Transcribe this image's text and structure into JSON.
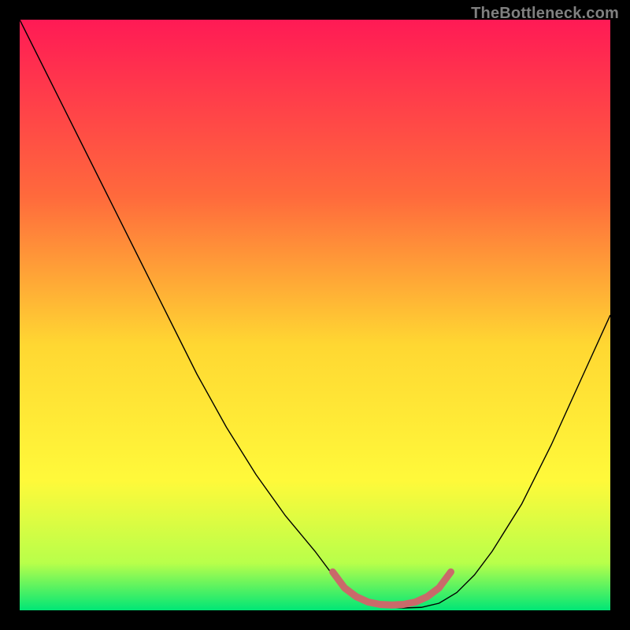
{
  "watermark": "TheBottleneck.com",
  "chart_data": {
    "type": "line",
    "title": "",
    "xlabel": "",
    "ylabel": "",
    "xlim": [
      0,
      100
    ],
    "ylim": [
      0,
      100
    ],
    "background_gradient": {
      "stops": [
        {
          "offset": 0.0,
          "color": "#ff1a55"
        },
        {
          "offset": 0.3,
          "color": "#ff6a3c"
        },
        {
          "offset": 0.55,
          "color": "#ffd732"
        },
        {
          "offset": 0.78,
          "color": "#fff93a"
        },
        {
          "offset": 0.92,
          "color": "#b8ff4a"
        },
        {
          "offset": 1.0,
          "color": "#00e676"
        }
      ]
    },
    "series": [
      {
        "name": "bottleneck-curve",
        "x": [
          0,
          5,
          10,
          15,
          20,
          25,
          30,
          35,
          40,
          45,
          50,
          53,
          56,
          59,
          62,
          65,
          68,
          71,
          74,
          77,
          80,
          85,
          90,
          95,
          100
        ],
        "y": [
          100,
          90,
          80,
          70,
          60,
          50,
          40,
          31,
          23,
          16,
          10,
          6,
          3,
          1.2,
          0.5,
          0.4,
          0.5,
          1.2,
          3,
          6,
          10,
          18,
          28,
          39,
          50
        ],
        "stroke": "#000000",
        "stroke_width": 1.4
      },
      {
        "name": "optimum-band",
        "x": [
          53,
          55,
          57,
          59,
          61,
          63,
          65,
          67,
          69,
          71,
          73
        ],
        "y": [
          6.5,
          3.8,
          2.3,
          1.4,
          1.0,
          0.9,
          1.0,
          1.4,
          2.3,
          3.8,
          6.5
        ],
        "stroke": "#c96a6a",
        "stroke_width": 9
      }
    ]
  }
}
